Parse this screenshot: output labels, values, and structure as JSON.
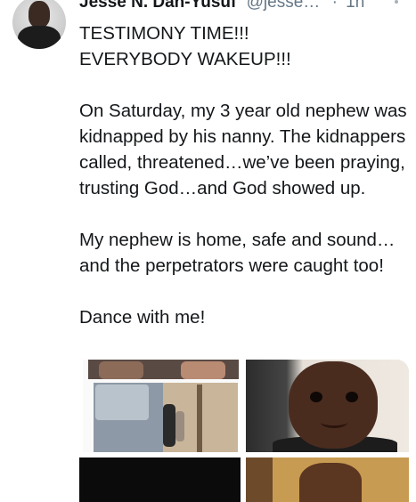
{
  "tweet": {
    "author_name": "Jesse N. Dan-Yusuf",
    "author_handle": "@jesse…",
    "separator": "·",
    "time": "1h",
    "lines": [
      "TESTIMONY TIME!!!",
      "EVERYBODY WAKEUP!!!",
      "",
      "On Saturday, my 3 year old nephew was kidnapped by his nanny. The kidnappers called, threatened…we’ve been praying, trusting God…and God showed up.",
      "",
      "My nephew is home, safe and sound… and the perpetrators were caught too!",
      "",
      "Dance with me!"
    ]
  },
  "icons": {
    "avatar": "profile-photo",
    "caret": "more-options-icon"
  },
  "colors": {
    "text": "#14171a",
    "secondary": "#657786",
    "background": "#ffffff"
  },
  "media": {
    "count": 4
  }
}
